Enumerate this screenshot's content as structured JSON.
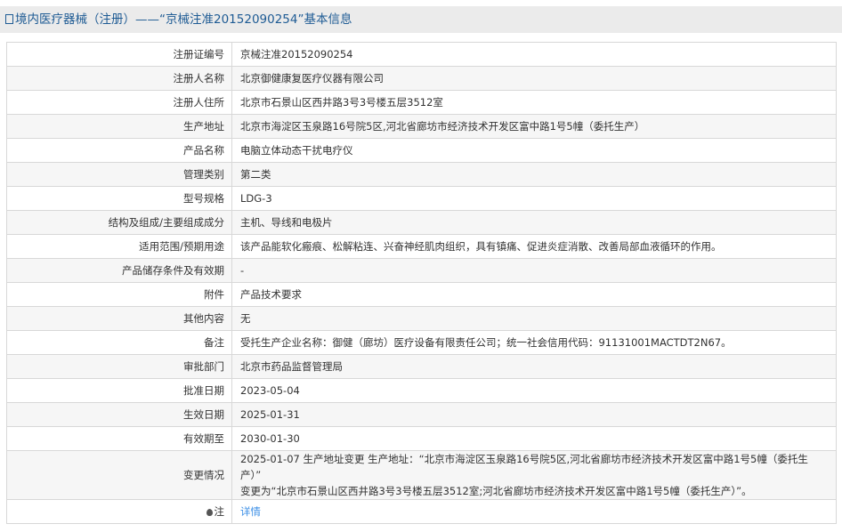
{
  "header": {
    "title": "境内医疗器械（注册）——“京械注准20152090254”基本信息"
  },
  "rows": [
    {
      "label": "注册证编号",
      "value": "京械注准20152090254"
    },
    {
      "label": "注册人名称",
      "value": "北京御健康复医疗仪器有限公司"
    },
    {
      "label": "注册人住所",
      "value": "北京市石景山区西井路3号3号楼五层3512室"
    },
    {
      "label": "生产地址",
      "value": "北京市海淀区玉泉路16号院5区,河北省廊坊市经济技术开发区富中路1号5幢（委托生产）"
    },
    {
      "label": "产品名称",
      "value": "电脑立体动态干扰电疗仪"
    },
    {
      "label": "管理类别",
      "value": "第二类"
    },
    {
      "label": "型号规格",
      "value": "LDG-3"
    },
    {
      "label": "结构及组成/主要组成成分",
      "value": "主机、导线和电极片"
    },
    {
      "label": "适用范围/预期用途",
      "value": "该产品能软化瘢痕、松解粘连、兴奋神经肌肉组织，具有镇痛、促进炎症消散、改善局部血液循环的作用。"
    },
    {
      "label": "产品储存条件及有效期",
      "value": "-"
    },
    {
      "label": "附件",
      "value": "产品技术要求"
    },
    {
      "label": "其他内容",
      "value": "无"
    },
    {
      "label": "备注",
      "value": "受托生产企业名称：御健（廊坊）医疗设备有限责任公司；统一社会信用代码：91131001MACTDT2N67。"
    },
    {
      "label": "审批部门",
      "value": "北京市药品监督管理局"
    },
    {
      "label": "批准日期",
      "value": "2023-05-04"
    },
    {
      "label": "生效日期",
      "value": "2025-01-31"
    },
    {
      "label": "有效期至",
      "value": "2030-01-30"
    },
    {
      "label": "变更情况",
      "value": "2025-01-07 生产地址变更 生产地址：“北京市海淀区玉泉路16号院5区,河北省廊坊市经济技术开发区富中路1号5幢（委托生产）”",
      "value2": "变更为“北京市石景山区西井路3号3号楼五层3512室;河北省廊坊市经济技术开发区富中路1号5幢（委托生产）”。"
    }
  ],
  "note": {
    "label": "注",
    "link": "详情"
  }
}
